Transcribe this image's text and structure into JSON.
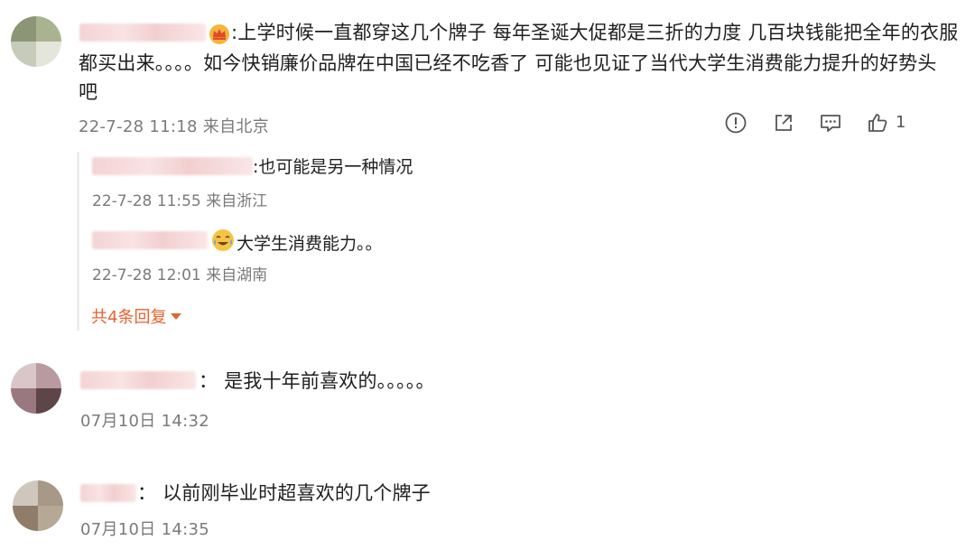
{
  "comments": [
    {
      "text_line1": ":上学时候一直都穿这几个牌子 每年圣诞大促都是三折的力度 几百块钱能把全年的衣服",
      "text_line2": "都买出来。。。。如今快销廉价品牌在中国已经不吃香了 可能也见证了当代大学生消费能力提升的好势头",
      "text_line3": "吧",
      "meta": "22-7-28 11:18 来自北京",
      "like_count": "1",
      "replies": [
        {
          "text": ":也可能是另一种情况",
          "meta": "22-7-28 11:55 来自浙江"
        },
        {
          "text": "大学生消费能力。。",
          "meta": "22-7-28 12:01 来自湖南"
        }
      ],
      "more_replies": "共4条回复"
    },
    {
      "text": "：  是我十年前喜欢的。。。。。",
      "meta": "07月10日 14:32"
    },
    {
      "text": "：  以前刚毕业时超喜欢的几个牌子",
      "meta": "07月10日 14:35"
    }
  ],
  "icons": {
    "badge": "crown-badge-icon",
    "report": "report-icon",
    "share": "share-icon",
    "comment": "comment-icon",
    "like": "like-icon",
    "reply_emoji": "laugh-cry-emoji-icon"
  },
  "colors": {
    "accent": "#e8612c",
    "meta": "#7a7a7a"
  }
}
